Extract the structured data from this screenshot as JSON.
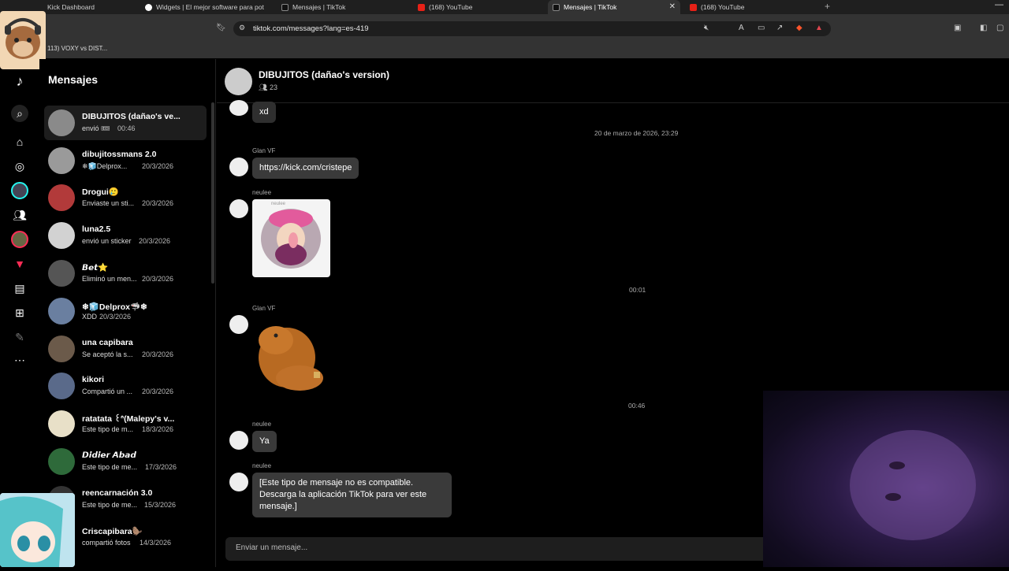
{
  "browser": {
    "tabs": [
      {
        "label": "Kick Dashboard",
        "icon": "kick-icon",
        "active": false
      },
      {
        "label": "Widgets | El mejor software para pot",
        "icon": "widgets-icon",
        "active": false
      },
      {
        "label": "Mensajes | TikTok",
        "icon": "tiktok-icon",
        "active": false
      },
      {
        "label": "(168) YouTube",
        "icon": "youtube-icon",
        "active": false
      },
      {
        "label": "Mensajes | TikTok",
        "icon": "tiktok-icon",
        "active": true
      },
      {
        "label": "(168) YouTube",
        "icon": "youtube-icon",
        "active": false
      }
    ],
    "url": "tiktok.com/messages?lang=es-419",
    "bookmark": "113) VOXY vs DIST..."
  },
  "sidebar": {
    "title": "Mensajes",
    "conversations": [
      {
        "name": "DIBUJITOS (dañao's ve...",
        "sub": "envió 🎟",
        "date": "00:46",
        "selected": true,
        "color": "#8a8a8a"
      },
      {
        "name": "dibujitossmans 2.0",
        "sub": "❄🧊Delprox...",
        "date": "20/3/2026",
        "color": "#9a9a9a"
      },
      {
        "name": "Drogui🥲",
        "sub": "Enviaste un sti...",
        "date": "20/3/2026",
        "color": "#b23a3a"
      },
      {
        "name": "luna2.5",
        "sub": "envió un sticker",
        "date": "20/3/2026",
        "color": "#d2d2d2"
      },
      {
        "name": "𝘽𝙚𝙩⭐",
        "sub": "Eliminó un men...",
        "date": "20/3/2026",
        "color": "#555"
      },
      {
        "name": "❄🧊Delprox🦈❄",
        "sub": "XDD",
        "date": "20/3/2026",
        "color": "#6a7fa0"
      },
      {
        "name": "una capibara",
        "sub": "Se aceptó la s...",
        "date": "20/3/2026",
        "color": "#6b5a4a"
      },
      {
        "name": "kikori",
        "sub": "Compartió un ...",
        "date": "20/3/2026",
        "color": "#5a6a8a"
      },
      {
        "name": "ratatata ꒰ᐢ(Malepy's v...",
        "sub": "Este tipo de m...",
        "date": "18/3/2026",
        "color": "#e8e0c8"
      },
      {
        "name": "𝘿𝙞𝙙𝙞𝙚𝙧 𝘼𝙗𝙖𝙙",
        "sub": "Este tipo de me...",
        "date": "17/3/2026",
        "color": "#2e6a3a"
      },
      {
        "name": "reencarnación 3.0",
        "sub": "Este tipo de me...",
        "date": "15/3/2026",
        "color": "#333"
      },
      {
        "name": "Criscapibara🦫",
        "sub": "compartió fotos",
        "date": "14/3/2026",
        "color": "#444"
      }
    ]
  },
  "chat": {
    "title": "DIBUJITOS (dañao's version)",
    "members": "23",
    "messages": [
      {
        "type": "text",
        "text": "xd"
      },
      {
        "type": "timestamp",
        "text": "20 de marzo de 2026, 23:29"
      },
      {
        "type": "text",
        "sender": "Glan VF",
        "text": "https://kick.com/cristepe"
      },
      {
        "type": "sticker",
        "sender": "neulee",
        "label": "neulee"
      },
      {
        "type": "timestamp",
        "text": "00:01"
      },
      {
        "type": "sticker",
        "sender": "Glan VF"
      },
      {
        "type": "timestamp",
        "text": "00:46"
      },
      {
        "type": "text",
        "sender": "neulee",
        "text": "Ya"
      },
      {
        "type": "text",
        "sender": "neulee",
        "text_lines": [
          "[Este tipo de mensaje no es compatible.",
          "Descarga la aplicación TikTok para ver este",
          "mensaje.]"
        ]
      }
    ],
    "composer_placeholder": "Enviar un mensaje..."
  },
  "colors": {
    "background": "#000000",
    "bubble": "#2f2f2f",
    "accent": "#fe2c55"
  }
}
